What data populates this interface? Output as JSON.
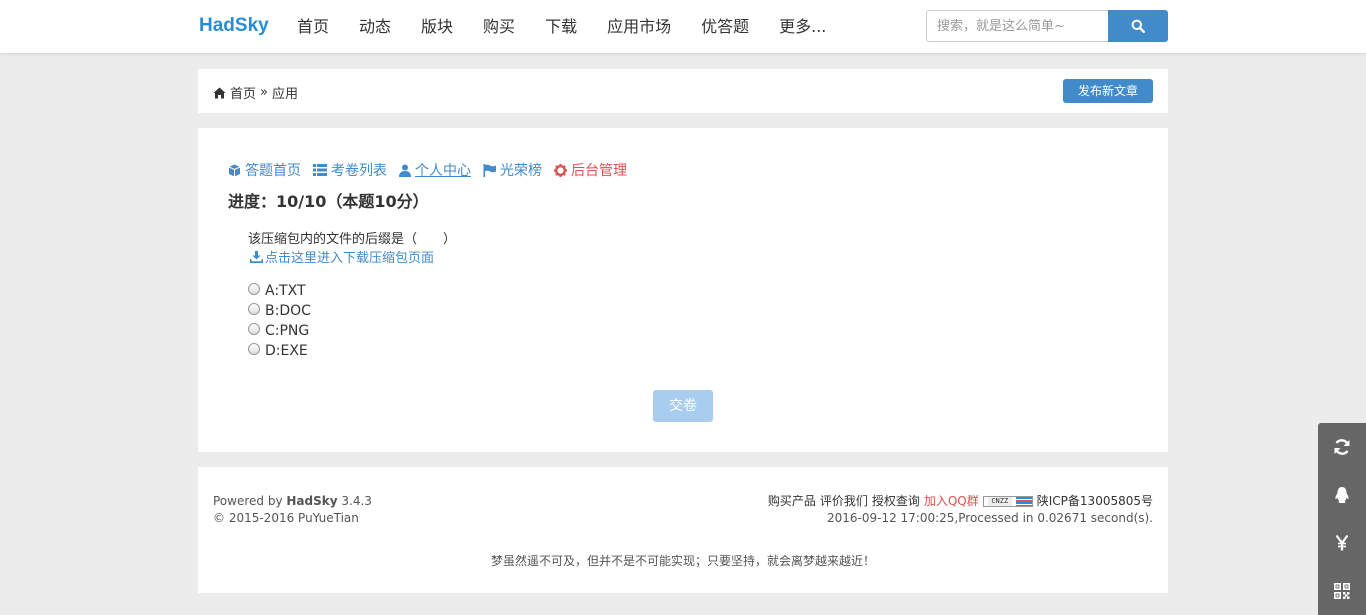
{
  "header": {
    "brand": "HadSky",
    "nav": [
      "首页",
      "动态",
      "版块",
      "购买",
      "下载",
      "应用市场",
      "优答题",
      "更多..."
    ],
    "search_placeholder": "搜索，就是这么简单~"
  },
  "breadcrumb": {
    "home": "首页",
    "separator": "»",
    "current": "应用",
    "new_post_button": "发布新文章"
  },
  "subnav": {
    "items": [
      {
        "label": "答题首页",
        "icon": "cube-icon"
      },
      {
        "label": "考卷列表",
        "icon": "list-icon"
      },
      {
        "label": "个人中心",
        "icon": "user-icon"
      },
      {
        "label": "光荣榜",
        "icon": "flag-icon"
      },
      {
        "label": "后台管理",
        "icon": "gear-icon"
      }
    ]
  },
  "quiz": {
    "progress": "进度：10/10（本题10分）",
    "question": "该压缩包内的文件的后缀是（　　）",
    "download_link": "点击这里进入下载压缩包页面",
    "options": [
      "A:TXT",
      "B:DOC",
      "C:PNG",
      "D:EXE"
    ],
    "submit": "交卷"
  },
  "footer": {
    "powered_prefix": "Powered by ",
    "powered_name": "HadSky",
    "powered_version": " 3.4.3",
    "copyright": "© 2015-2016 PuYueTian",
    "links": [
      "购买产品",
      "评价我们",
      "授权查询"
    ],
    "qq_group": "加入QQ群",
    "cnzz_badge": "CNZZ",
    "icp": "陕ICP备13005805号",
    "processed": "2016-09-12 17:00:25,Processed in 0.02671 second(s).",
    "motto": "梦虽然遥不可及，但并不是不可能实现；只要坚持，就会离梦越来越近！"
  },
  "sidebar": {
    "buttons": [
      "refresh-icon",
      "qq-icon",
      "yen-icon",
      "qrcode-icon"
    ]
  },
  "colors": {
    "brand": "#2a8dd4",
    "primary": "#428bca",
    "danger": "#d9534f",
    "submit_disabled": "#a8cdee"
  }
}
